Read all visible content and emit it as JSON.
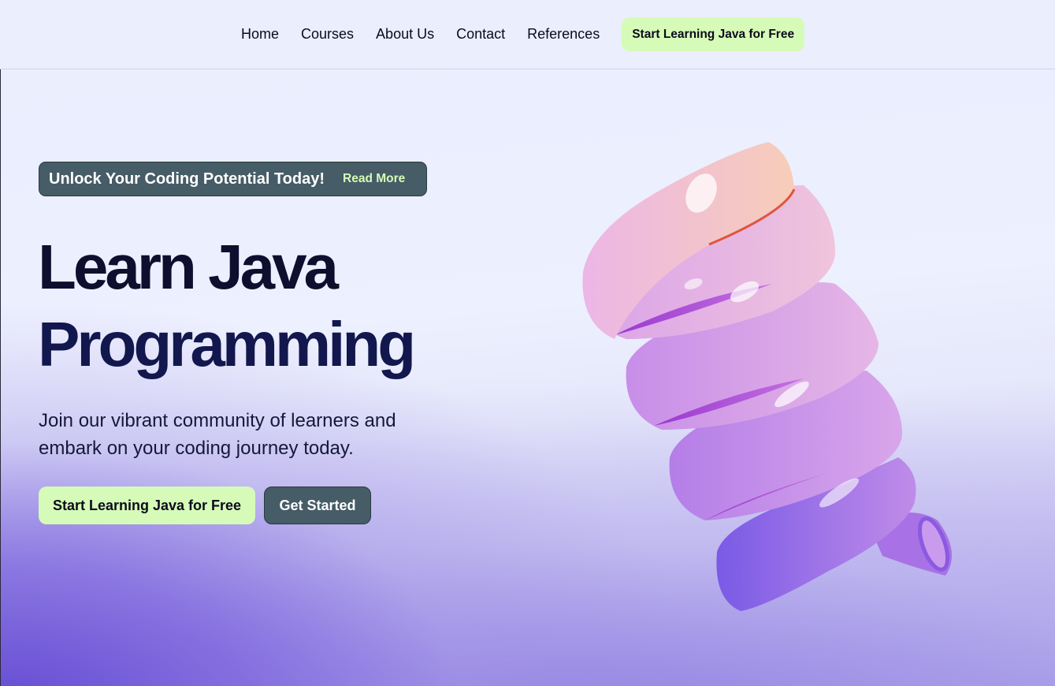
{
  "nav": {
    "links": [
      "Home",
      "Courses",
      "About Us",
      "Contact",
      "References"
    ],
    "cta_label": "Start Learning Java for Free"
  },
  "banner": {
    "text": "Unlock Your Coding Potential Today!",
    "link_label": "Read More"
  },
  "hero": {
    "title_line1": "Learn Java",
    "title_line2": "Programming",
    "subtitle": "Join our vibrant community of learners and embark on your coding journey today.",
    "primary_button": "Start Learning Java for Free",
    "secondary_button": "Get Started"
  },
  "colors": {
    "accent_green": "#d6fbb8",
    "slate": "#465c66",
    "background": "#eaeefe",
    "gradient_purple": "#6046d2"
  },
  "illustration": {
    "name": "3d-spiral-helix-illustration"
  }
}
